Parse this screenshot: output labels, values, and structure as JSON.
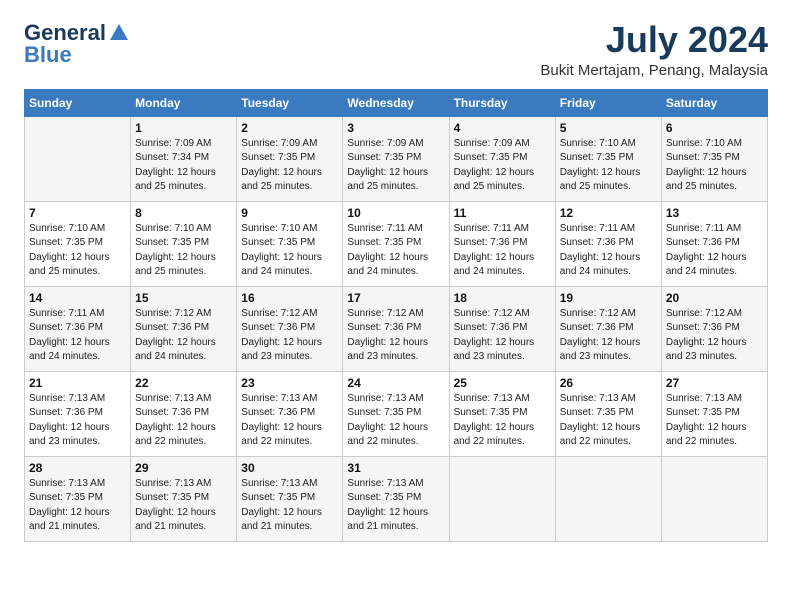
{
  "header": {
    "logo_line1": "General",
    "logo_line2": "Blue",
    "month_year": "July 2024",
    "location": "Bukit Mertajam, Penang, Malaysia"
  },
  "days_of_week": [
    "Sunday",
    "Monday",
    "Tuesday",
    "Wednesday",
    "Thursday",
    "Friday",
    "Saturday"
  ],
  "weeks": [
    [
      {
        "day": "",
        "sunrise": "",
        "sunset": "",
        "daylight": ""
      },
      {
        "day": "1",
        "sunrise": "Sunrise: 7:09 AM",
        "sunset": "Sunset: 7:34 PM",
        "daylight": "Daylight: 12 hours and 25 minutes."
      },
      {
        "day": "2",
        "sunrise": "Sunrise: 7:09 AM",
        "sunset": "Sunset: 7:35 PM",
        "daylight": "Daylight: 12 hours and 25 minutes."
      },
      {
        "day": "3",
        "sunrise": "Sunrise: 7:09 AM",
        "sunset": "Sunset: 7:35 PM",
        "daylight": "Daylight: 12 hours and 25 minutes."
      },
      {
        "day": "4",
        "sunrise": "Sunrise: 7:09 AM",
        "sunset": "Sunset: 7:35 PM",
        "daylight": "Daylight: 12 hours and 25 minutes."
      },
      {
        "day": "5",
        "sunrise": "Sunrise: 7:10 AM",
        "sunset": "Sunset: 7:35 PM",
        "daylight": "Daylight: 12 hours and 25 minutes."
      },
      {
        "day": "6",
        "sunrise": "Sunrise: 7:10 AM",
        "sunset": "Sunset: 7:35 PM",
        "daylight": "Daylight: 12 hours and 25 minutes."
      }
    ],
    [
      {
        "day": "7",
        "sunrise": "Sunrise: 7:10 AM",
        "sunset": "Sunset: 7:35 PM",
        "daylight": "Daylight: 12 hours and 25 minutes."
      },
      {
        "day": "8",
        "sunrise": "Sunrise: 7:10 AM",
        "sunset": "Sunset: 7:35 PM",
        "daylight": "Daylight: 12 hours and 25 minutes."
      },
      {
        "day": "9",
        "sunrise": "Sunrise: 7:10 AM",
        "sunset": "Sunset: 7:35 PM",
        "daylight": "Daylight: 12 hours and 24 minutes."
      },
      {
        "day": "10",
        "sunrise": "Sunrise: 7:11 AM",
        "sunset": "Sunset: 7:35 PM",
        "daylight": "Daylight: 12 hours and 24 minutes."
      },
      {
        "day": "11",
        "sunrise": "Sunrise: 7:11 AM",
        "sunset": "Sunset: 7:36 PM",
        "daylight": "Daylight: 12 hours and 24 minutes."
      },
      {
        "day": "12",
        "sunrise": "Sunrise: 7:11 AM",
        "sunset": "Sunset: 7:36 PM",
        "daylight": "Daylight: 12 hours and 24 minutes."
      },
      {
        "day": "13",
        "sunrise": "Sunrise: 7:11 AM",
        "sunset": "Sunset: 7:36 PM",
        "daylight": "Daylight: 12 hours and 24 minutes."
      }
    ],
    [
      {
        "day": "14",
        "sunrise": "Sunrise: 7:11 AM",
        "sunset": "Sunset: 7:36 PM",
        "daylight": "Daylight: 12 hours and 24 minutes."
      },
      {
        "day": "15",
        "sunrise": "Sunrise: 7:12 AM",
        "sunset": "Sunset: 7:36 PM",
        "daylight": "Daylight: 12 hours and 24 minutes."
      },
      {
        "day": "16",
        "sunrise": "Sunrise: 7:12 AM",
        "sunset": "Sunset: 7:36 PM",
        "daylight": "Daylight: 12 hours and 23 minutes."
      },
      {
        "day": "17",
        "sunrise": "Sunrise: 7:12 AM",
        "sunset": "Sunset: 7:36 PM",
        "daylight": "Daylight: 12 hours and 23 minutes."
      },
      {
        "day": "18",
        "sunrise": "Sunrise: 7:12 AM",
        "sunset": "Sunset: 7:36 PM",
        "daylight": "Daylight: 12 hours and 23 minutes."
      },
      {
        "day": "19",
        "sunrise": "Sunrise: 7:12 AM",
        "sunset": "Sunset: 7:36 PM",
        "daylight": "Daylight: 12 hours and 23 minutes."
      },
      {
        "day": "20",
        "sunrise": "Sunrise: 7:12 AM",
        "sunset": "Sunset: 7:36 PM",
        "daylight": "Daylight: 12 hours and 23 minutes."
      }
    ],
    [
      {
        "day": "21",
        "sunrise": "Sunrise: 7:13 AM",
        "sunset": "Sunset: 7:36 PM",
        "daylight": "Daylight: 12 hours and 23 minutes."
      },
      {
        "day": "22",
        "sunrise": "Sunrise: 7:13 AM",
        "sunset": "Sunset: 7:36 PM",
        "daylight": "Daylight: 12 hours and 22 minutes."
      },
      {
        "day": "23",
        "sunrise": "Sunrise: 7:13 AM",
        "sunset": "Sunset: 7:36 PM",
        "daylight": "Daylight: 12 hours and 22 minutes."
      },
      {
        "day": "24",
        "sunrise": "Sunrise: 7:13 AM",
        "sunset": "Sunset: 7:35 PM",
        "daylight": "Daylight: 12 hours and 22 minutes."
      },
      {
        "day": "25",
        "sunrise": "Sunrise: 7:13 AM",
        "sunset": "Sunset: 7:35 PM",
        "daylight": "Daylight: 12 hours and 22 minutes."
      },
      {
        "day": "26",
        "sunrise": "Sunrise: 7:13 AM",
        "sunset": "Sunset: 7:35 PM",
        "daylight": "Daylight: 12 hours and 22 minutes."
      },
      {
        "day": "27",
        "sunrise": "Sunrise: 7:13 AM",
        "sunset": "Sunset: 7:35 PM",
        "daylight": "Daylight: 12 hours and 22 minutes."
      }
    ],
    [
      {
        "day": "28",
        "sunrise": "Sunrise: 7:13 AM",
        "sunset": "Sunset: 7:35 PM",
        "daylight": "Daylight: 12 hours and 21 minutes."
      },
      {
        "day": "29",
        "sunrise": "Sunrise: 7:13 AM",
        "sunset": "Sunset: 7:35 PM",
        "daylight": "Daylight: 12 hours and 21 minutes."
      },
      {
        "day": "30",
        "sunrise": "Sunrise: 7:13 AM",
        "sunset": "Sunset: 7:35 PM",
        "daylight": "Daylight: 12 hours and 21 minutes."
      },
      {
        "day": "31",
        "sunrise": "Sunrise: 7:13 AM",
        "sunset": "Sunset: 7:35 PM",
        "daylight": "Daylight: 12 hours and 21 minutes."
      },
      {
        "day": "",
        "sunrise": "",
        "sunset": "",
        "daylight": ""
      },
      {
        "day": "",
        "sunrise": "",
        "sunset": "",
        "daylight": ""
      },
      {
        "day": "",
        "sunrise": "",
        "sunset": "",
        "daylight": ""
      }
    ]
  ]
}
